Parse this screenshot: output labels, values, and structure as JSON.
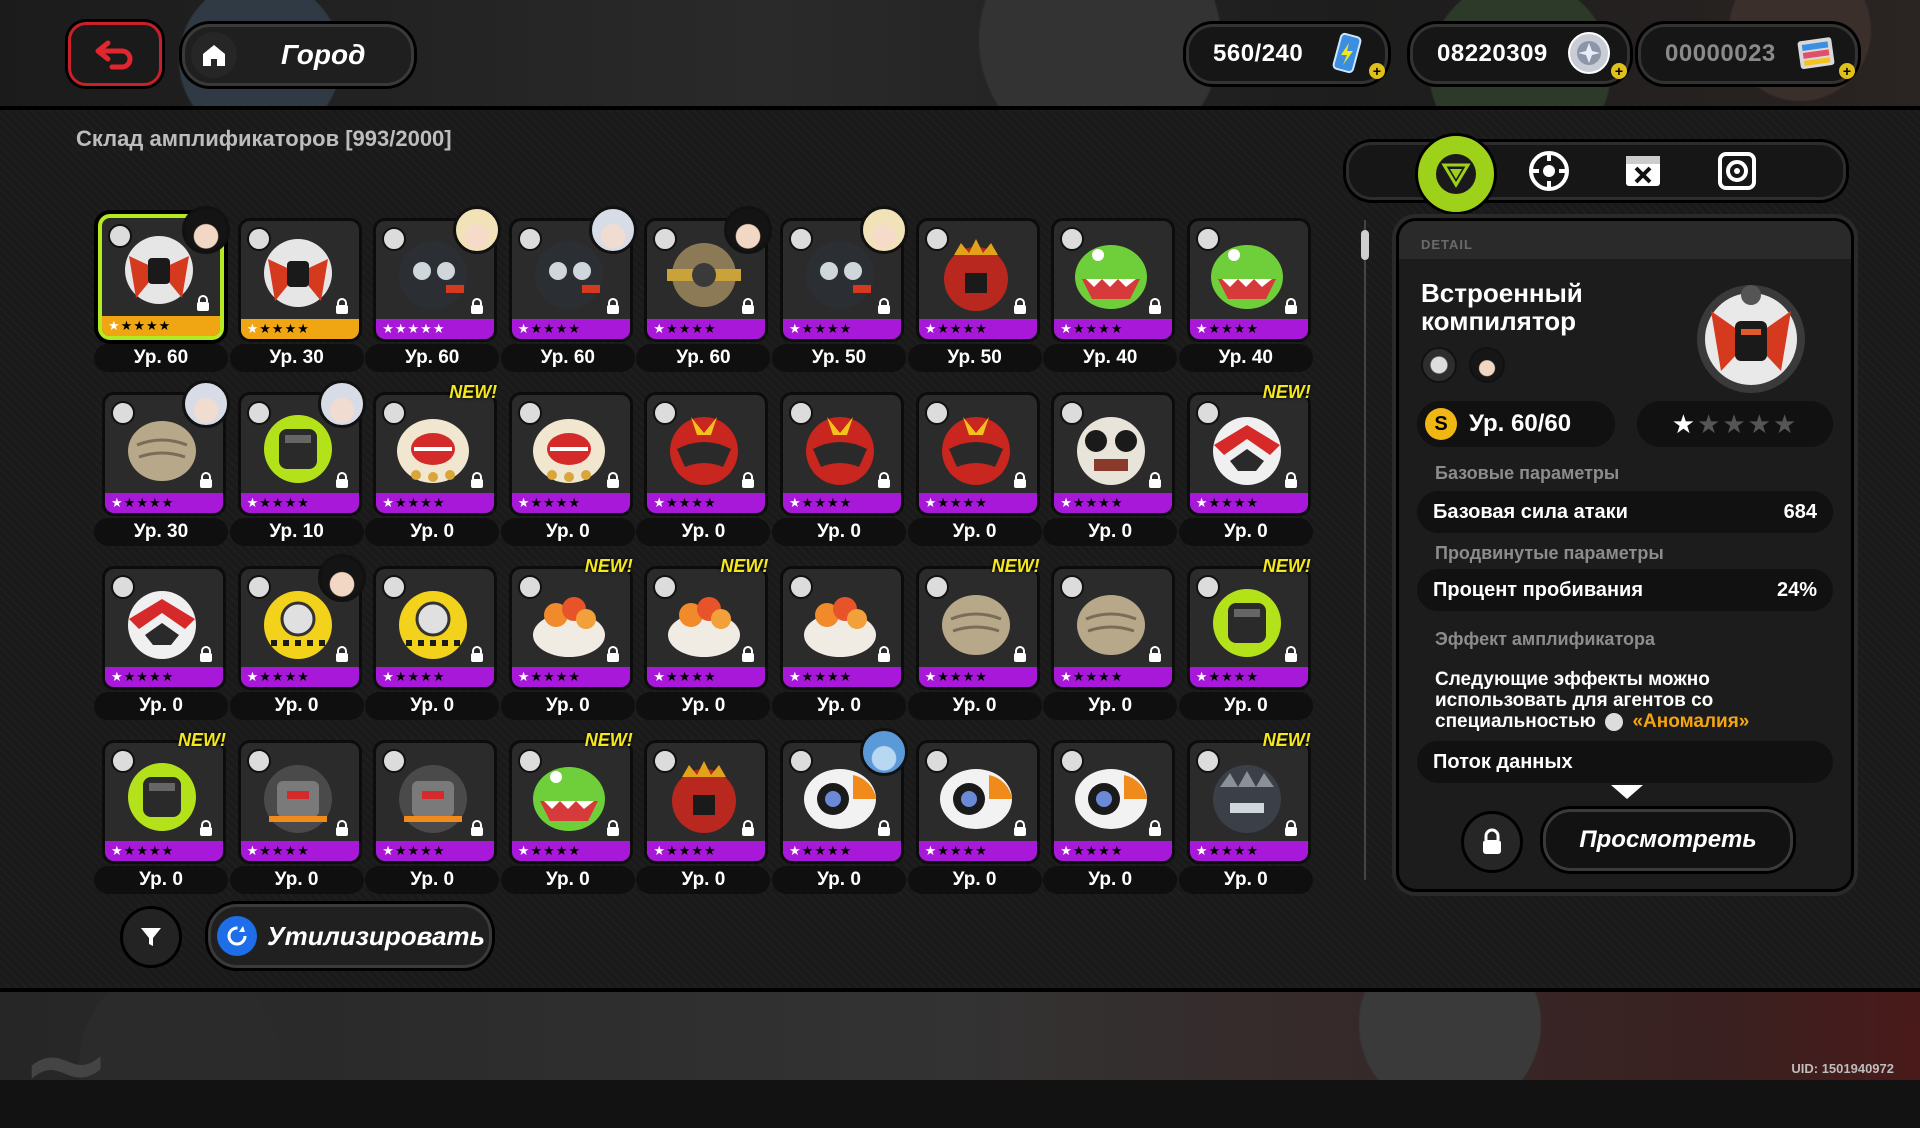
{
  "colors": {
    "accent_green": "#9ed11a",
    "rank_s_purple": "#a818d8",
    "rank_a_orange": "#f0a613",
    "new_yellow": "#f4e71c",
    "highlight_orange": "#f4a412",
    "back_red": "#c9202a"
  },
  "header": {
    "back_icon": "back-arrow-icon",
    "home_icon": "home-icon",
    "location": "Город",
    "battery": {
      "value": "560/240",
      "icon": "battery-icon"
    },
    "currency1": {
      "value": "08220309",
      "icon": "coin-icon"
    },
    "currency2": {
      "value": "00000023",
      "icon": "film-ticket-icon"
    }
  },
  "storage_title": "Склад амплификаторов [993/2000]",
  "new_label": "NEW!",
  "items": [
    {
      "level": "Ур. 60",
      "rank": "A",
      "art": "compiler",
      "agent": "dark",
      "new": false,
      "selected": true,
      "stars": 1
    },
    {
      "level": "Ур. 30",
      "rank": "A",
      "art": "compiler",
      "agent": null,
      "new": false,
      "selected": false,
      "stars": 1
    },
    {
      "level": "Ур. 60",
      "rank": "S",
      "art": "bomb",
      "agent": "blonde",
      "new": false,
      "selected": false,
      "stars": 5
    },
    {
      "level": "Ур. 60",
      "rank": "S",
      "art": "bomb",
      "agent": "silver",
      "new": false,
      "selected": false,
      "stars": 1
    },
    {
      "level": "Ур. 60",
      "rank": "S",
      "art": "gear",
      "agent": "dark",
      "new": false,
      "selected": false,
      "stars": 1
    },
    {
      "level": "Ур. 50",
      "rank": "S",
      "art": "bomb",
      "agent": "blonde",
      "new": false,
      "selected": false,
      "stars": 1
    },
    {
      "level": "Ур. 50",
      "rank": "S",
      "art": "crown",
      "agent": null,
      "new": false,
      "selected": false,
      "stars": 1
    },
    {
      "level": "Ур. 40",
      "rank": "S",
      "art": "croc",
      "agent": null,
      "new": false,
      "selected": false,
      "stars": 1
    },
    {
      "level": "Ур. 40",
      "rank": "S",
      "art": "croc",
      "agent": null,
      "new": false,
      "selected": false,
      "stars": 1
    },
    {
      "level": "Ур. 30",
      "rank": "S",
      "art": "rock",
      "agent": "silver",
      "new": false,
      "selected": false,
      "stars": 1
    },
    {
      "level": "Ур. 10",
      "rank": "S",
      "art": "lime",
      "agent": "silver",
      "new": false,
      "selected": false,
      "stars": 1
    },
    {
      "level": "Ур. 0",
      "rank": "S",
      "art": "cream",
      "agent": null,
      "new": true,
      "selected": false,
      "stars": 1
    },
    {
      "level": "Ур. 0",
      "rank": "S",
      "art": "cream",
      "agent": null,
      "new": false,
      "selected": false,
      "stars": 1
    },
    {
      "level": "Ур. 0",
      "rank": "S",
      "art": "redhelm",
      "agent": null,
      "new": false,
      "selected": false,
      "stars": 1
    },
    {
      "level": "Ур. 0",
      "rank": "S",
      "art": "redhelm",
      "agent": null,
      "new": false,
      "selected": false,
      "stars": 1
    },
    {
      "level": "Ур. 0",
      "rank": "S",
      "art": "redhelm",
      "agent": null,
      "new": false,
      "selected": false,
      "stars": 1
    },
    {
      "level": "Ур. 0",
      "rank": "S",
      "art": "panda",
      "agent": null,
      "new": false,
      "selected": false,
      "stars": 1
    },
    {
      "level": "Ур. 0",
      "rank": "S",
      "art": "redwhite",
      "agent": null,
      "new": true,
      "selected": false,
      "stars": 1
    },
    {
      "level": "Ур. 0",
      "rank": "S",
      "art": "redwhite",
      "agent": null,
      "new": false,
      "selected": false,
      "stars": 1
    },
    {
      "level": "Ур. 0",
      "rank": "S",
      "art": "yellow",
      "agent": "dark",
      "new": false,
      "selected": false,
      "stars": 1
    },
    {
      "level": "Ур. 0",
      "rank": "S",
      "art": "yellow",
      "agent": null,
      "new": false,
      "selected": false,
      "stars": 1
    },
    {
      "level": "Ур. 0",
      "rank": "S",
      "art": "bowl",
      "agent": null,
      "new": true,
      "selected": false,
      "stars": 1
    },
    {
      "level": "Ур. 0",
      "rank": "S",
      "art": "bowl",
      "agent": null,
      "new": true,
      "selected": false,
      "stars": 1
    },
    {
      "level": "Ур. 0",
      "rank": "S",
      "art": "bowl",
      "agent": null,
      "new": false,
      "selected": false,
      "stars": 1
    },
    {
      "level": "Ур. 0",
      "rank": "S",
      "art": "rock",
      "agent": null,
      "new": true,
      "selected": false,
      "stars": 1
    },
    {
      "level": "Ур. 0",
      "rank": "S",
      "art": "rock",
      "agent": null,
      "new": false,
      "selected": false,
      "stars": 1
    },
    {
      "level": "Ур. 0",
      "rank": "S",
      "art": "lime",
      "agent": null,
      "new": true,
      "selected": false,
      "stars": 1
    },
    {
      "level": "Ур. 0",
      "rank": "S",
      "art": "lime",
      "agent": null,
      "new": true,
      "selected": false,
      "stars": 1
    },
    {
      "level": "Ур. 0",
      "rank": "S",
      "art": "greyorange",
      "agent": null,
      "new": false,
      "selected": false,
      "stars": 1
    },
    {
      "level": "Ур. 0",
      "rank": "S",
      "art": "greyorange",
      "agent": null,
      "new": false,
      "selected": false,
      "stars": 1
    },
    {
      "level": "Ур. 0",
      "rank": "S",
      "art": "croc",
      "agent": null,
      "new": true,
      "selected": false,
      "stars": 1
    },
    {
      "level": "Ур. 0",
      "rank": "S",
      "art": "crown",
      "agent": null,
      "new": false,
      "selected": false,
      "stars": 1
    },
    {
      "level": "Ур. 0",
      "rank": "S",
      "art": "camera",
      "agent": "blue",
      "new": false,
      "selected": false,
      "stars": 1
    },
    {
      "level": "Ур. 0",
      "rank": "S",
      "art": "camera",
      "agent": null,
      "new": false,
      "selected": false,
      "stars": 1
    },
    {
      "level": "Ур. 0",
      "rank": "S",
      "art": "camera",
      "agent": null,
      "new": false,
      "selected": false,
      "stars": 1
    },
    {
      "level": "Ур. 0",
      "rank": "S",
      "art": "darkbeast",
      "agent": null,
      "new": true,
      "selected": false,
      "stars": 1
    }
  ],
  "toolbar": {
    "filter_icon": "filter-funnel-icon",
    "recycle_icon": "recycle-icon",
    "recycle_label": "Утилизировать"
  },
  "tabs": [
    {
      "icon": "amplifier-triangle-icon",
      "active": true
    },
    {
      "icon": "disc-drive-icon",
      "active": false
    },
    {
      "icon": "box-x-icon",
      "active": false
    },
    {
      "icon": "safe-disc-icon",
      "active": false
    }
  ],
  "detail": {
    "label": "DETAIL",
    "name": "Встроенный компилятор",
    "rank": "S",
    "level": "Ур. 60/60",
    "stars_filled": 1,
    "stars_total": 5,
    "base_section": "Базовые параметры",
    "base_stat": {
      "name": "Базовая сила атаки",
      "value": "684"
    },
    "adv_section": "Продвинутые параметры",
    "adv_stat": {
      "name": "Процент пробивания",
      "value": "24%"
    },
    "effect_section": "Эффект амплификатора",
    "effect_text": "Следующие эффекты можно использовать для агентов со специальностью",
    "effect_highlight": "«Аномалия»",
    "stream": "Поток данных",
    "view_label": "Просмотреть",
    "lock_icon": "lock-icon"
  },
  "uid": "UID: 1501940972"
}
